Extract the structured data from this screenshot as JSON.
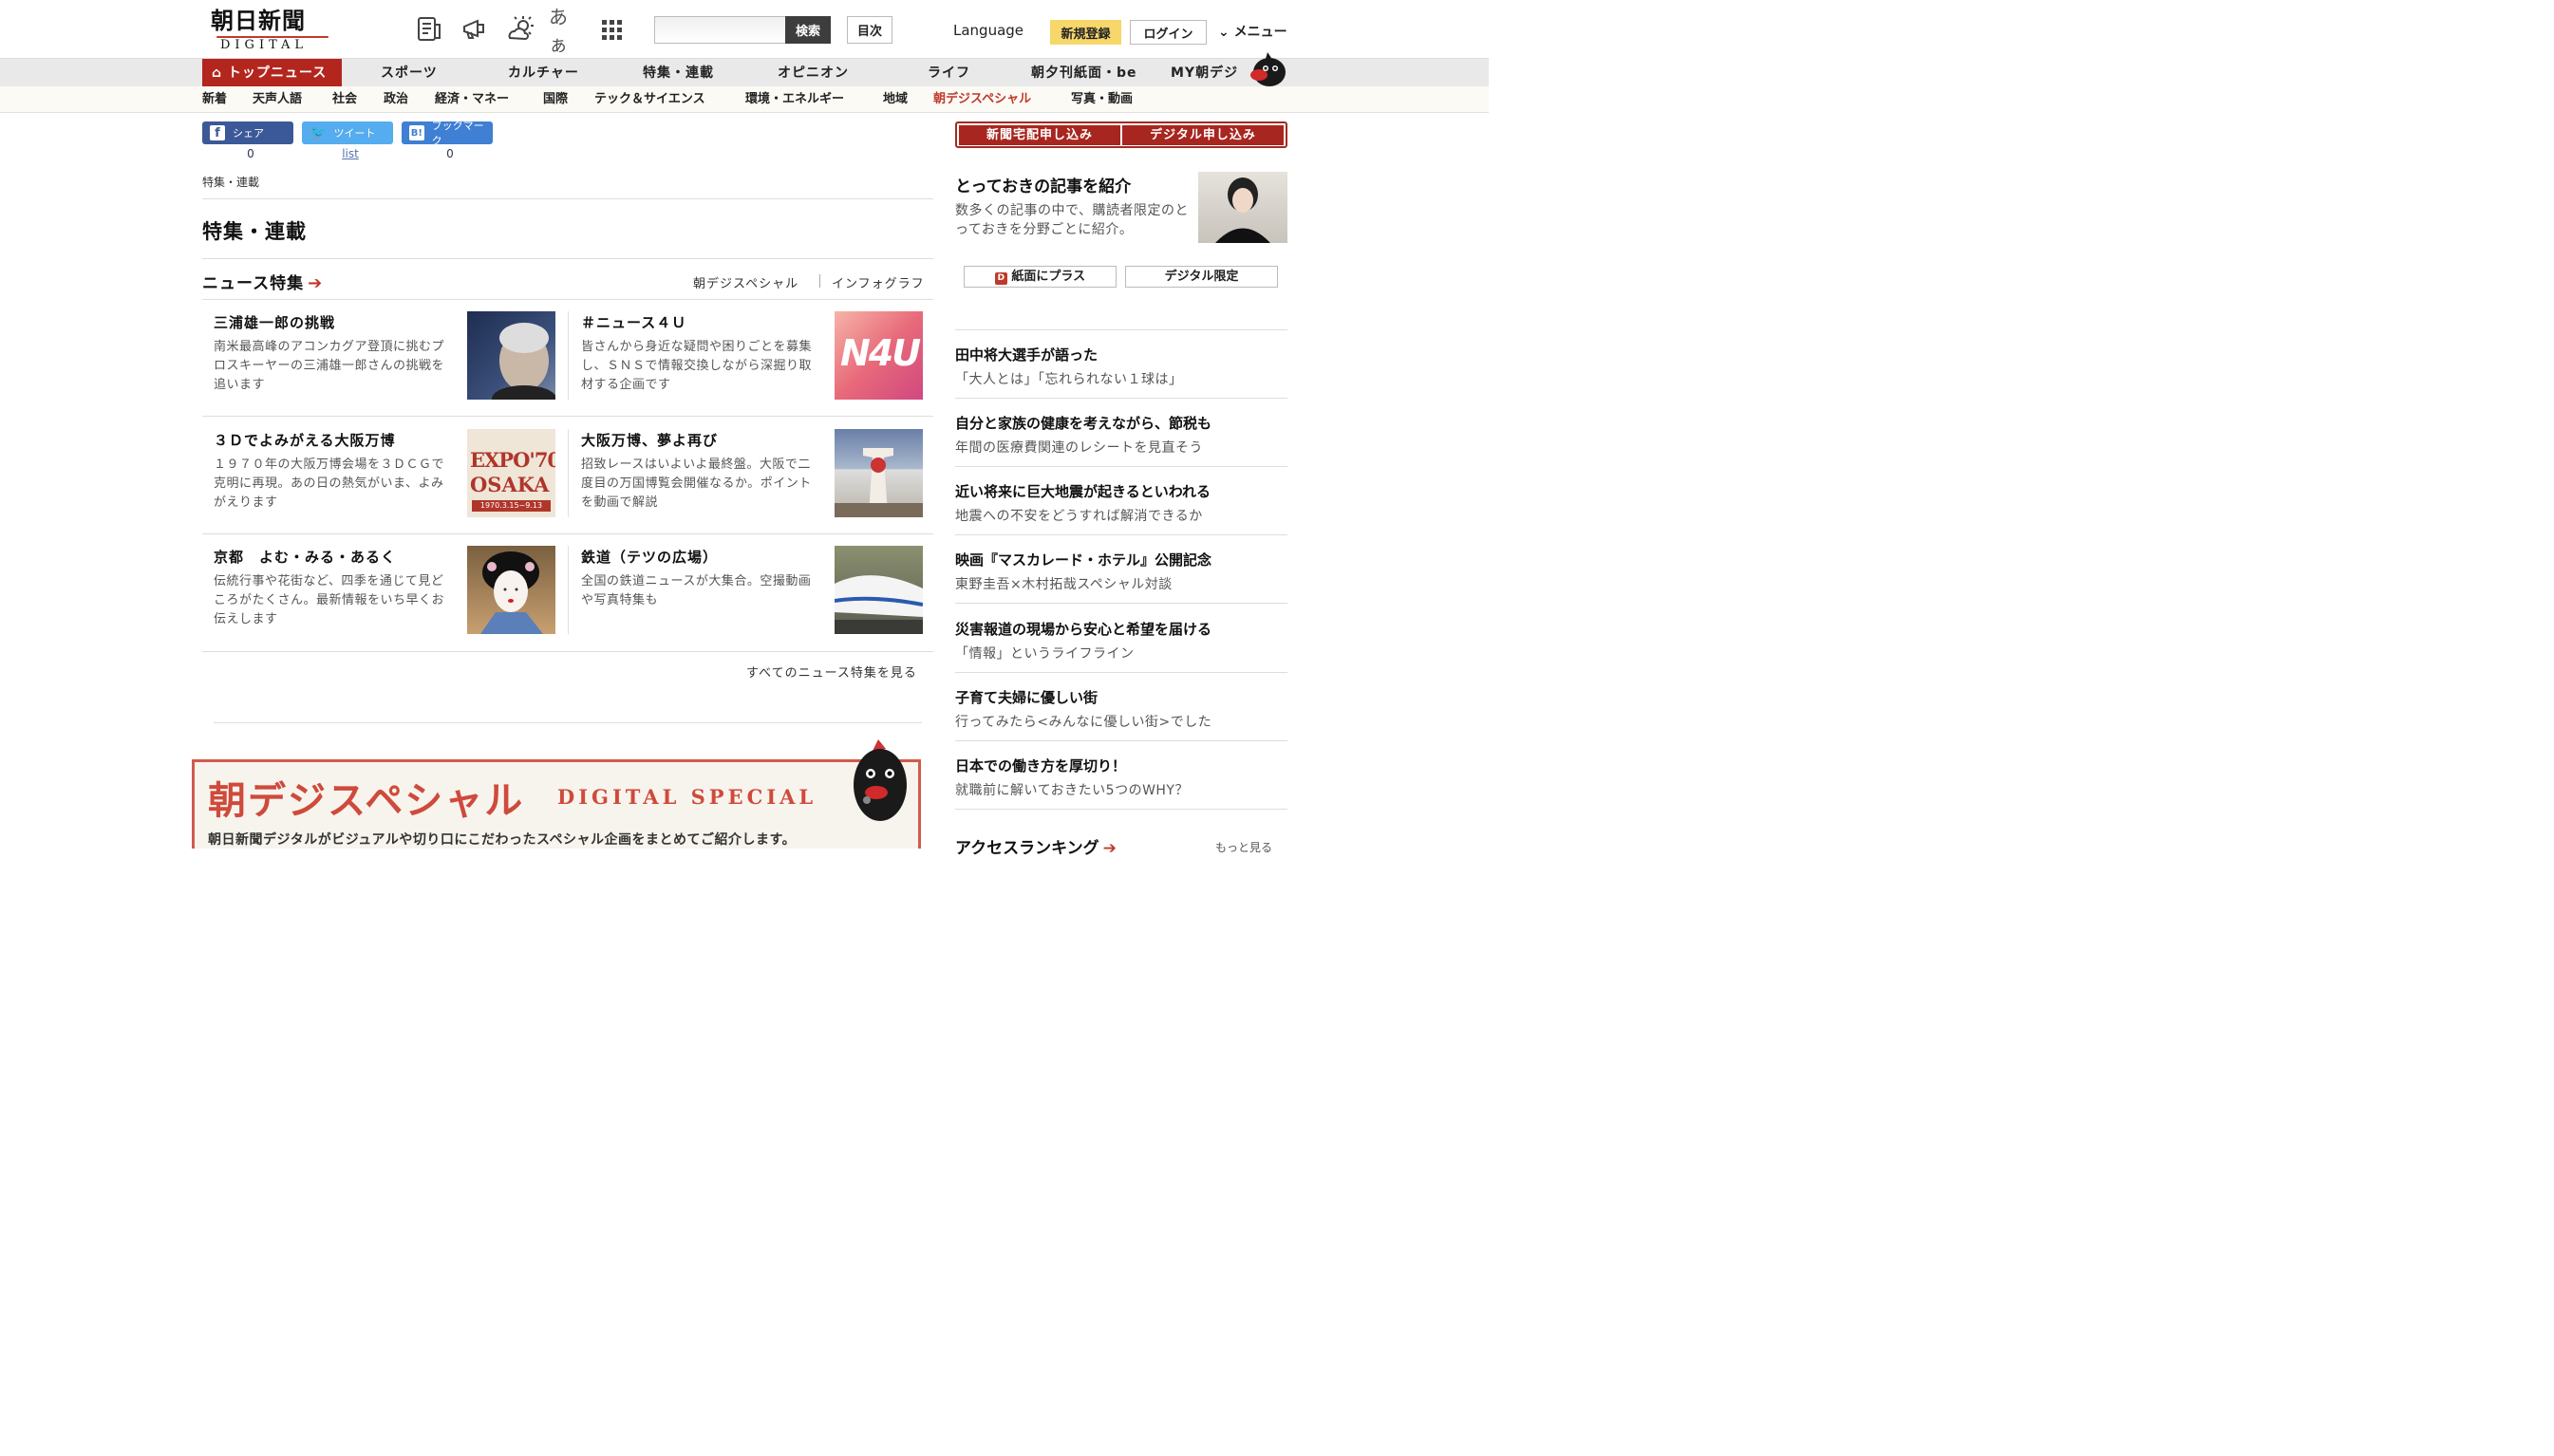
{
  "header": {
    "logo_main": "朝日新聞",
    "logo_sub": "DIGITAL",
    "icons": [
      "newspaper-icon",
      "megaphone-icon",
      "weather-icon",
      "font-size-icon",
      "grid-menu-icon"
    ],
    "font_size_glyph": "あぁ",
    "search_placeholder": "",
    "search_button": "検索",
    "mokuji_button": "目次",
    "language": "Language",
    "register": "新規登録",
    "login": "ログイン",
    "menu": "メニュー"
  },
  "nav_main": [
    "トップニュース",
    "スポーツ",
    "カルチャー",
    "特集・連載",
    "オピニオン",
    "ライフ",
    "朝夕刊紙面・be",
    "MY朝デジ"
  ],
  "nav_sub": [
    "新着",
    "天声人語",
    "社会",
    "政治",
    "経済・マネー",
    "国際",
    "テック＆サイエンス",
    "環境・エネルギー",
    "地域",
    "朝デジスペシャル",
    "写真・動画"
  ],
  "share": {
    "facebook": {
      "label": "シェア",
      "count": "0"
    },
    "twitter": {
      "label": "ツイート",
      "count": "list"
    },
    "hatena": {
      "label": "ブックマーク",
      "count": "0"
    }
  },
  "breadcrumb": "特集・連載",
  "page_title": "特集・連載",
  "news_features": {
    "title": "ニュース特集",
    "links": [
      "朝デジスペシャル",
      "インフォグラフ"
    ],
    "items": [
      {
        "title": "三浦雄一郎の挑戦",
        "desc": "南米最高峰のアコンカグア登頂に挑むプロスキーヤーの三浦雄一郎さんの挑戦を追います"
      },
      {
        "title": "＃ニュース４Ｕ",
        "desc": "皆さんから身近な疑問や困りごとを募集し、ＳＮＳで情報交換しながら深掘り取材する企画です",
        "img_text": "N4U"
      },
      {
        "title": "３Ｄでよみがえる大阪万博",
        "desc": "１９７０年の大阪万博会場を３ＤＣＧで克明に再現。あの日の熱気がいま、よみがえります",
        "img_text1": "EXPO'70",
        "img_text2": "OSAKA",
        "img_text3": "1970.3.15~9.13"
      },
      {
        "title": "大阪万博、夢よ再び",
        "desc": "招致レースはいよいよ最終盤。大阪で二度目の万国博覧会開催なるか。ポイントを動画で解説"
      },
      {
        "title": "京都　よむ・みる・あるく",
        "desc": "伝統行事や花街など、四季を通じて見どころがたくさん。最新情報をいち早くお伝えします"
      },
      {
        "title": "鉄道（テツの広場）",
        "desc": "全国の鉄道ニュースが大集合。空撮動画や写真特集も"
      }
    ],
    "see_all": "すべてのニュース特集を見る"
  },
  "special_banner": {
    "title": "朝デジスペシャル",
    "title_en": "DIGITAL SPECIAL",
    "desc": "朝日新聞デジタルがビジュアルや切り口にこだわったスペシャル企画をまとめてご紹介します。"
  },
  "sidebar": {
    "subscribe_paper": "新聞宅配申し込み",
    "subscribe_digital": "デジタル申し込み",
    "promo_title": "とっておきの記事を紹介",
    "promo_desc": "数多くの記事の中で、購読者限定のとっておきを分野ごとに紹介。",
    "tab_paper": "紙面にプラス",
    "tab_digital": "デジタル限定",
    "items": [
      {
        "title": "田中将大選手が語った",
        "sub": "「大人とは」「忘れられない１球は」"
      },
      {
        "title": "自分と家族の健康を考えながら、節税も",
        "sub": "年間の医療費関連のレシートを見直そう"
      },
      {
        "title": "近い将来に巨大地震が起きるといわれる",
        "sub": "地震への不安をどうすれば解消できるか"
      },
      {
        "title": "映画『マスカレード・ホテル』公開記念",
        "sub": "東野圭吾×木村拓哉スペシャル対談"
      },
      {
        "title": "災害報道の現場から安心と希望を届ける",
        "sub": "「情報」というライフライン"
      },
      {
        "title": "子育て夫婦に優しい街",
        "sub": "行ってみたら<みんなに優しい街>でした"
      },
      {
        "title": "日本での働き方を厚切り！",
        "sub": "就職前に解いておきたい5つのWHY？"
      }
    ],
    "ranking_title": "アクセスランキング",
    "ranking_more": "もっと見る"
  },
  "colors": {
    "brand_red": "#b3261e",
    "accent_yellow": "#f7d66a",
    "link_blue": "#5570b0"
  }
}
